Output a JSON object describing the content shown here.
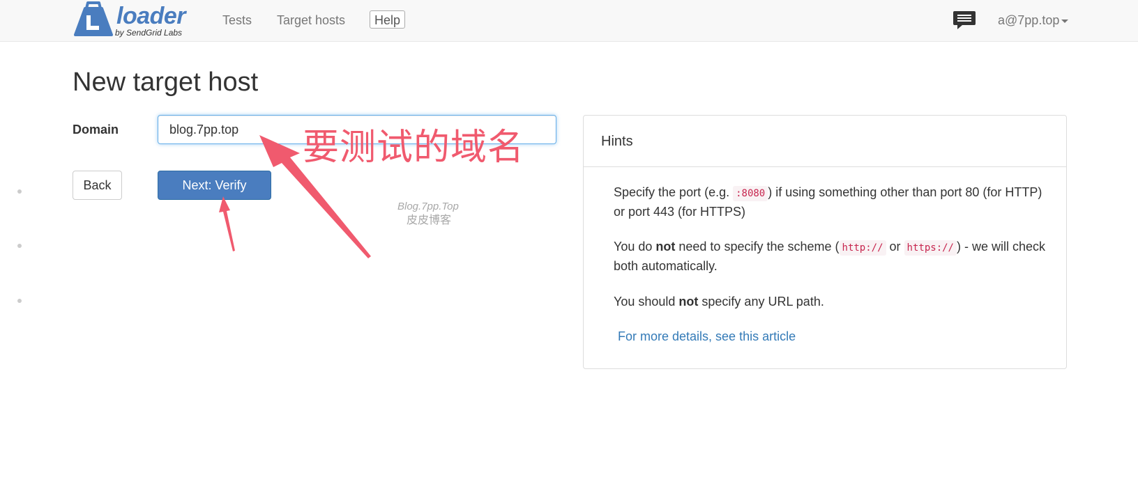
{
  "header": {
    "brand": "loader",
    "brand_sub": "by SendGrid Labs",
    "nav": {
      "tests": "Tests",
      "target_hosts": "Target hosts",
      "help": "Help"
    },
    "user": "a@7pp.top"
  },
  "page": {
    "title": "New target host",
    "domain_label": "Domain",
    "domain_value": "blog.7pp.top",
    "back_button": "Back",
    "next_button": "Next: Verify"
  },
  "hints": {
    "title": "Hints",
    "items": [
      {
        "pre": "Specify the port (e.g. ",
        "code": ":8080",
        "post": ") if using something other than port 80 (for HTTP) or port 443 (for HTTPS)"
      },
      {
        "pre": "You do ",
        "bold": "not",
        "mid": " need to specify the scheme (",
        "code1": "http://",
        "or": " or ",
        "code2": "https://",
        "post": ") - we will check both automatically."
      },
      {
        "pre": "You should ",
        "bold": "not",
        "post": " specify any URL path."
      }
    ],
    "more_link": "For more details, see this article"
  },
  "annotation": {
    "label": "要测试的域名",
    "watermark_line1": "Blog.7pp.Top",
    "watermark_line2": "皮皮博客"
  },
  "colors": {
    "brand": "#4a7dbf",
    "primary_button": "#4a7dbf",
    "annotation": "#f05a6e",
    "link": "#337ab7"
  }
}
